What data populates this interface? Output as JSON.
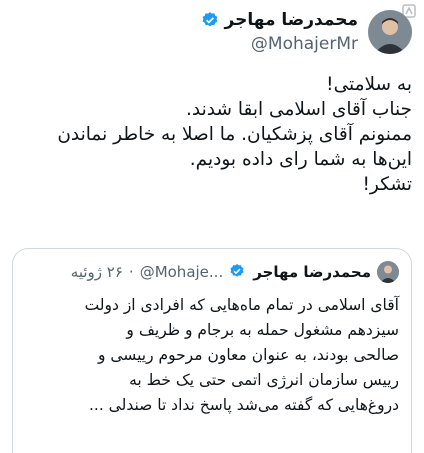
{
  "tweet": {
    "author_name": "محمدرضا مهاجر",
    "author_handle": "@MohajerMr",
    "verified_color": "#1d9bf0",
    "text": "به سلامتی!\nجناب آقای اسلامی ابقا شدند.\nممنونم آقای پزشکیان. ما اصلا به خاطر نماندن\nاین‌ها به شما رای داده بودیم.\nتشکر!"
  },
  "quoted_tweet": {
    "author_name": "محمدرضا مهاجر",
    "author_handle": "@Mohaje...",
    "date": "۲۶ ژوئیه",
    "separator": "·",
    "text": "آقای اسلامی در تمام ماه‌هایی که افرادی از دولت\nسیزدهم مشغول حمله به برجام و ظریف و\nصالحی بودند، به عنوان معاون مرحوم رییسی و\nرییس سازمان انرژی اتمی حتی یک خط به\nدروغ‌هایی که گفته می‌شد پاسخ نداد تا صندلی ..."
  },
  "watermark": {
    "icon": "watermark-logo-icon"
  }
}
